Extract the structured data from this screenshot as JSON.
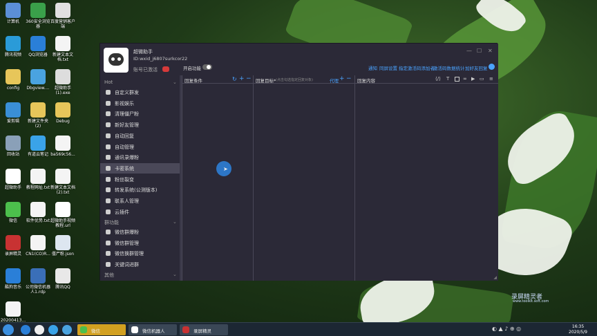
{
  "desktop": {
    "icons": [
      {
        "label": "计算机",
        "color": "#5b8fd6"
      },
      {
        "label": "360安全浏览器",
        "color": "#3aa04a"
      },
      {
        "label": "百度营销客户端",
        "color": "#e0e0e0"
      },
      {
        "label": "腾讯视频",
        "color": "#2a9bd8"
      },
      {
        "label": "QQ浏览器",
        "color": "#2a7fd8"
      },
      {
        "label": "新建文本文档.txt",
        "color": "#f4f4f4"
      },
      {
        "label": "config",
        "color": "#e7c65a"
      },
      {
        "label": "Dbgview....",
        "color": "#4aa3e0"
      },
      {
        "label": "超微助手(1).exe",
        "color": "#dddddd"
      },
      {
        "label": "爱剪辑",
        "color": "#3a8fd6"
      },
      {
        "label": "新建文件夹(2)",
        "color": "#e7c65a"
      },
      {
        "label": "Debug",
        "color": "#e7c65a"
      },
      {
        "label": "回收站",
        "color": "#8aa0b8"
      },
      {
        "label": "有道云笔记",
        "color": "#3aa3e8"
      },
      {
        "label": "ba569c56...",
        "color": "#f4f4f4"
      },
      {
        "label": "超微助手",
        "color": "#ffffff"
      },
      {
        "label": "教程网址.txt",
        "color": "#f4f4f4"
      },
      {
        "label": "新建文本文档(2).txt",
        "color": "#f4f4f4"
      },
      {
        "label": "微信",
        "color": "#4cbf4c"
      },
      {
        "label": "软件优势.txt",
        "color": "#f4f4f4"
      },
      {
        "label": "超微助手视频教程.url",
        "color": "#ffffff"
      },
      {
        "label": "录屏精灵",
        "color": "#c83232"
      },
      {
        "label": "CN1(CO)R...",
        "color": "#f4f4f4"
      },
      {
        "label": "僵尸粉.json",
        "color": "#dde6f0"
      },
      {
        "label": "酷狗音乐",
        "color": "#2a7fd8"
      },
      {
        "label": "公司微信机器人1.rdp",
        "color": "#3a6fb8"
      },
      {
        "label": "腾讯QQ",
        "color": "#e8e8e8"
      },
      {
        "label": "20200413...",
        "color": "#f4f4f4"
      }
    ]
  },
  "app": {
    "name": "超微助手",
    "id": "ID:wxid_j6807surkcor22",
    "activation": "账号已激活",
    "window_controls": [
      "—",
      "☐",
      "✕"
    ],
    "toolbar": {
      "switch_label": "开启功能",
      "links": [
        "通知",
        "同屏设置",
        "指定激活码添加者",
        "激活码数据统计",
        "加好友回复"
      ]
    },
    "sidebar": {
      "hot_section": "Hot",
      "group_section": "群功能",
      "other_section": "其他",
      "items": [
        {
          "label": "自定义群发",
          "icon": "message-icon"
        },
        {
          "label": "影视娱乐",
          "icon": "film-icon"
        },
        {
          "label": "清理僵尸粉",
          "icon": "skull-icon"
        },
        {
          "label": "新好友管理",
          "icon": "user-icon"
        },
        {
          "label": "自动回复",
          "icon": "reply-icon"
        },
        {
          "label": "自动管理",
          "icon": "gear-icon"
        },
        {
          "label": "通讯录爆粉",
          "icon": "contacts-icon"
        },
        {
          "label": "卡密系统",
          "icon": "code-icon"
        },
        {
          "label": "粉丝裂变",
          "icon": "share-icon"
        },
        {
          "label": "转发系统(公测版本)",
          "icon": "forward-icon"
        },
        {
          "label": "联系人管理",
          "icon": "people-icon"
        },
        {
          "label": "云插件",
          "icon": "cloud-icon"
        }
      ],
      "group_items": [
        {
          "label": "微信群爆粉",
          "icon": "chat-icon"
        },
        {
          "label": "微信群管理",
          "icon": "bank-icon"
        },
        {
          "label": "微信换群管理",
          "icon": "swap-icon"
        },
        {
          "label": "关键词进群",
          "icon": "list-icon"
        }
      ]
    },
    "panels": {
      "conditions": {
        "title": "回复条件"
      },
      "targets": {
        "title": "回复目标*",
        "hint": "(点击勾选指定回复对象)",
        "proxy": "代理"
      },
      "content": {
        "title": "回复内容"
      }
    }
  },
  "taskbar": {
    "buttons": [
      "微信",
      "微信机器人",
      "录屏精灵"
    ],
    "time": "16:35",
    "date": "2020/5/9"
  },
  "watermark": {
    "title": "录屏精灵者",
    "url": "www.toolkit.soft.com"
  }
}
